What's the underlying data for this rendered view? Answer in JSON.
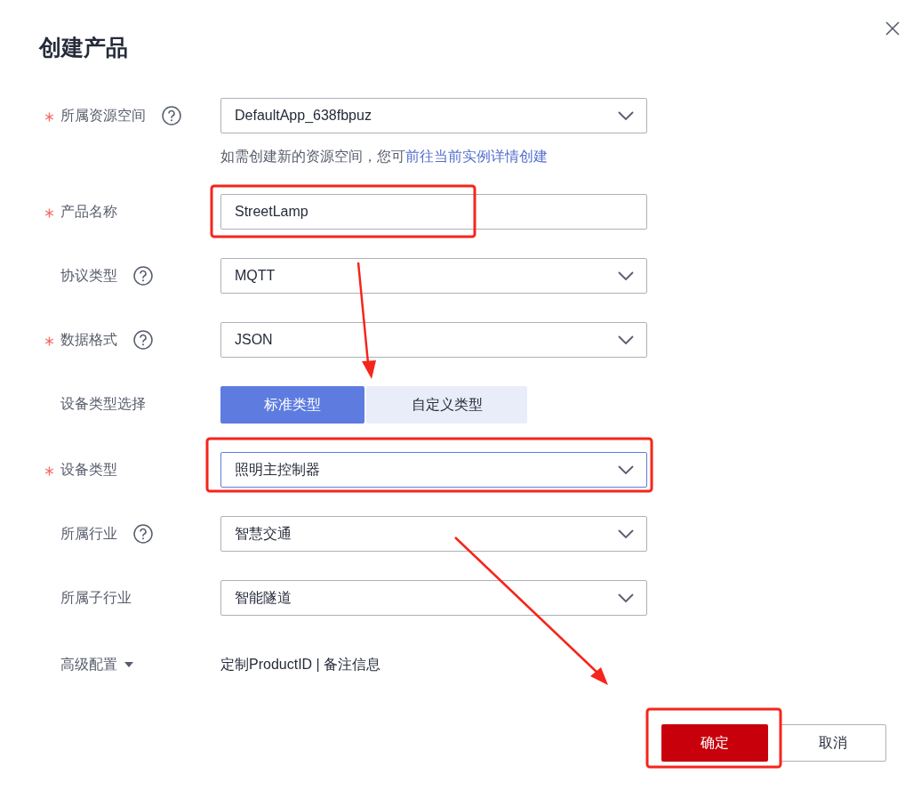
{
  "dialog": {
    "title": "创建产品"
  },
  "fields": [
    {
      "kind": "select",
      "label": "所属资源空间",
      "required": true,
      "help": true,
      "value": "DefaultApp_638fbpuz",
      "focused": false,
      "hint": {
        "text": "如需创建新的资源空间，您可",
        "link": "前往当前实例详情创建"
      }
    },
    {
      "kind": "input",
      "label": "产品名称",
      "required": true,
      "help": false,
      "value": "StreetLamp",
      "focused": false
    },
    {
      "kind": "select",
      "label": "协议类型",
      "required": false,
      "help": true,
      "value": "MQTT",
      "focused": false
    },
    {
      "kind": "select",
      "label": "数据格式",
      "required": true,
      "help": true,
      "value": "JSON",
      "focused": false
    },
    {
      "kind": "segmented",
      "label": "设备类型选择",
      "required": false,
      "help": false,
      "options": [
        {
          "label": "标准类型",
          "selected": true
        },
        {
          "label": "自定义类型",
          "selected": false
        }
      ]
    },
    {
      "kind": "select",
      "label": "设备类型",
      "required": true,
      "help": false,
      "value": "照明主控制器",
      "focused": true
    },
    {
      "kind": "select",
      "label": "所属行业",
      "required": false,
      "help": true,
      "value": "智慧交通",
      "focused": false
    },
    {
      "kind": "select",
      "label": "所属子行业",
      "required": false,
      "help": false,
      "value": "智能隧道",
      "focused": false
    },
    {
      "kind": "expander",
      "label": "高级配置",
      "required": false,
      "help": false,
      "expanded": false,
      "value": "定制ProductID | 备注信息"
    }
  ],
  "buttons": [
    {
      "label": "确定",
      "primary": true
    },
    {
      "label": "取消",
      "primary": false
    }
  ]
}
